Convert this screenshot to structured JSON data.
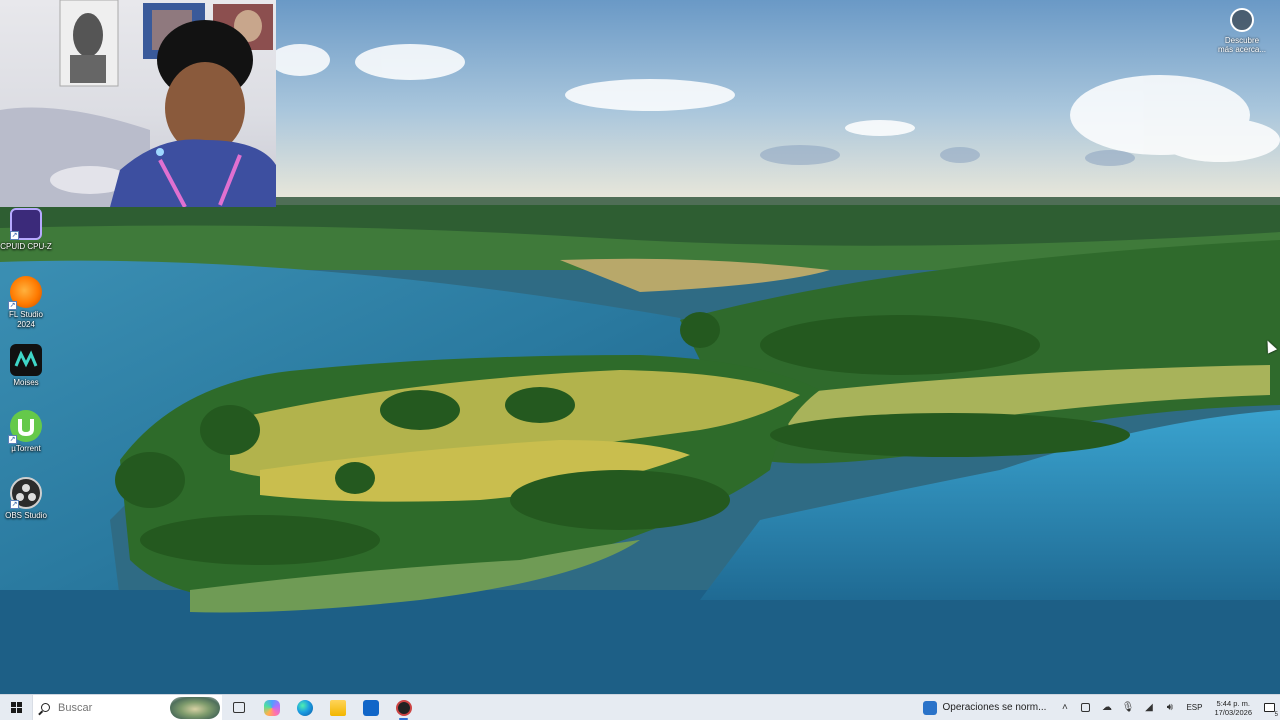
{
  "desktop": {
    "icons": [
      {
        "label": "CPUID CPU-Z",
        "icon": "cpuz-icon"
      },
      {
        "label": "FL Studio 2024",
        "icon": "fl-studio-icon"
      },
      {
        "label": "Moises",
        "icon": "moises-icon"
      },
      {
        "label": "µTorrent",
        "icon": "utorrent-icon"
      },
      {
        "label": "OBS Studio",
        "icon": "obs-studio-icon"
      }
    ],
    "discover": {
      "label": "Descubre más acerca...",
      "icon": "camera-lens-icon"
    }
  },
  "taskbar": {
    "search_placeholder": "Buscar",
    "apps": [
      {
        "icon": "task-view-icon",
        "label": "Vista de tareas"
      },
      {
        "icon": "copilot-icon",
        "label": "Copilot"
      },
      {
        "icon": "edge-icon",
        "label": "Microsoft Edge"
      },
      {
        "icon": "file-explorer-icon",
        "label": "Explorador de archivos"
      },
      {
        "icon": "outlook-icon",
        "label": "Outlook"
      },
      {
        "icon": "obs-icon",
        "label": "OBS Studio",
        "active": true
      }
    ],
    "widget_text": "Operaciones se norm...",
    "tray": {
      "language": "ESP",
      "time": "5:44 p. m.",
      "date": "17/03/2026",
      "notification_count": "5"
    }
  },
  "colors": {
    "taskbar_bg": "#e6ebf2",
    "accent": "#2f6fd6",
    "water": "#2f6b84",
    "sky": "#86aed0"
  }
}
